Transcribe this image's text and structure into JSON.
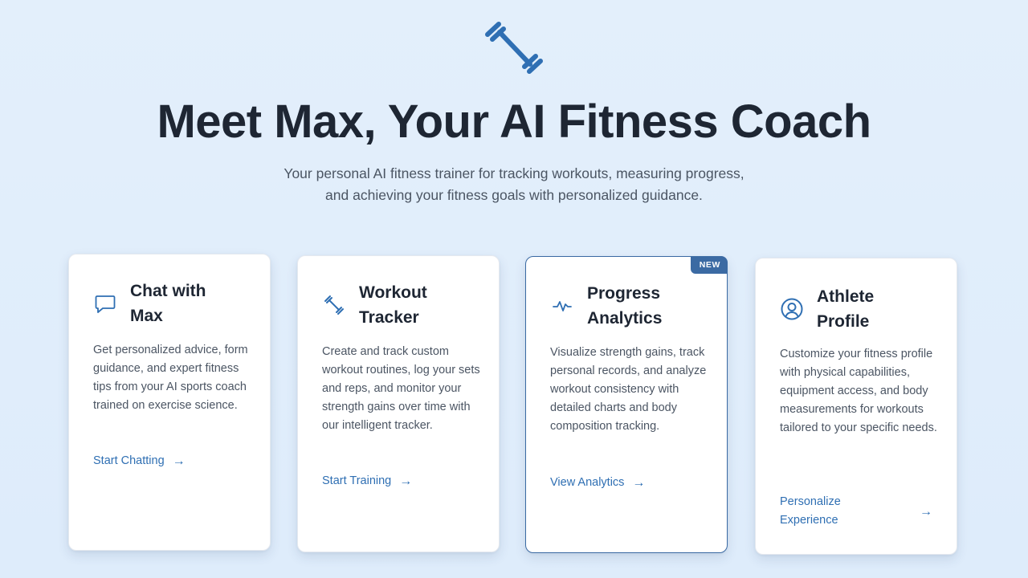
{
  "header": {
    "title": "Meet Max, Your AI Fitness Coach",
    "subtitle_line1": "Your personal AI fitness trainer for tracking workouts, measuring progress,",
    "subtitle_line2": "and achieving your fitness goals with personalized guidance."
  },
  "cards": [
    {
      "icon": "chat-icon",
      "title_line1": "Chat with",
      "title_line2": "Max",
      "desc": "Get personalized advice, form guidance, and expert fitness tips from your AI sports coach trained on exercise science.",
      "link": "Start Chatting",
      "badge": ""
    },
    {
      "icon": "dumbbell-icon",
      "title_line1": "Workout",
      "title_line2": "Tracker",
      "desc": "Create and track custom workout routines, log your sets and reps, and monitor your strength gains over time with our intelligent tracker.",
      "link": "Start Training",
      "badge": ""
    },
    {
      "icon": "activity-icon",
      "title_line1": "Progress",
      "title_line2": "Analytics",
      "desc": "Visualize strength gains, track personal records, and analyze workout consistency with detailed charts and body composition tracking.",
      "link": "View Analytics",
      "badge": "NEW"
    },
    {
      "icon": "user-circle-icon",
      "title_line1": "Athlete",
      "title_line2": "Profile",
      "desc": "Customize your fitness profile with physical capabilities, equipment access, and body measurements for workouts tailored to your specific needs.",
      "link_line1": "Personalize",
      "link_line2": "Experience",
      "badge": ""
    }
  ],
  "colors": {
    "accent": "#2f6fb3",
    "badge": "#3b6aa3",
    "background": "#e3effb",
    "heading": "#1e2633"
  }
}
